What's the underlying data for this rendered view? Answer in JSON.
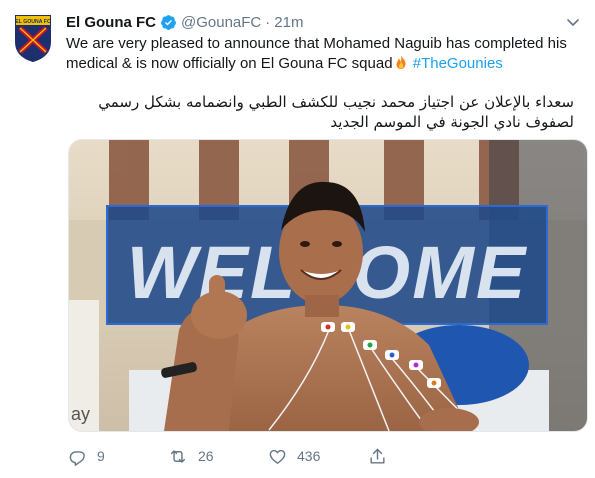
{
  "account": {
    "name": "El Gouna FC",
    "handle": "@GounaFC",
    "separator": "·",
    "time": "21m",
    "logo_text": "EL GOUNA FC"
  },
  "tweet": {
    "text_part1": "We are very pleased to announce that Mohamed Naguib has completed his medical & is now officially on El Gouna FC squad",
    "hashtag": "#TheGounies",
    "arabic": "سعداء بالإعلان عن اجتياز محمد نجيب للكشف الطبي وانضمامه بشكل رسمي لصفوف نادي الجونة في الموسم الجديد"
  },
  "media": {
    "banner_text": "WELCOME",
    "sign_text": "ay"
  },
  "actions": {
    "replies": "9",
    "retweets": "26",
    "likes": "436"
  },
  "icons": [
    "verified-badge-icon",
    "caret-down-icon",
    "reply-icon",
    "retweet-icon",
    "like-icon",
    "share-icon",
    "fire-icon"
  ],
  "colors": {
    "accent": "#1da1f2",
    "muted": "#657786",
    "text": "#14171a"
  }
}
